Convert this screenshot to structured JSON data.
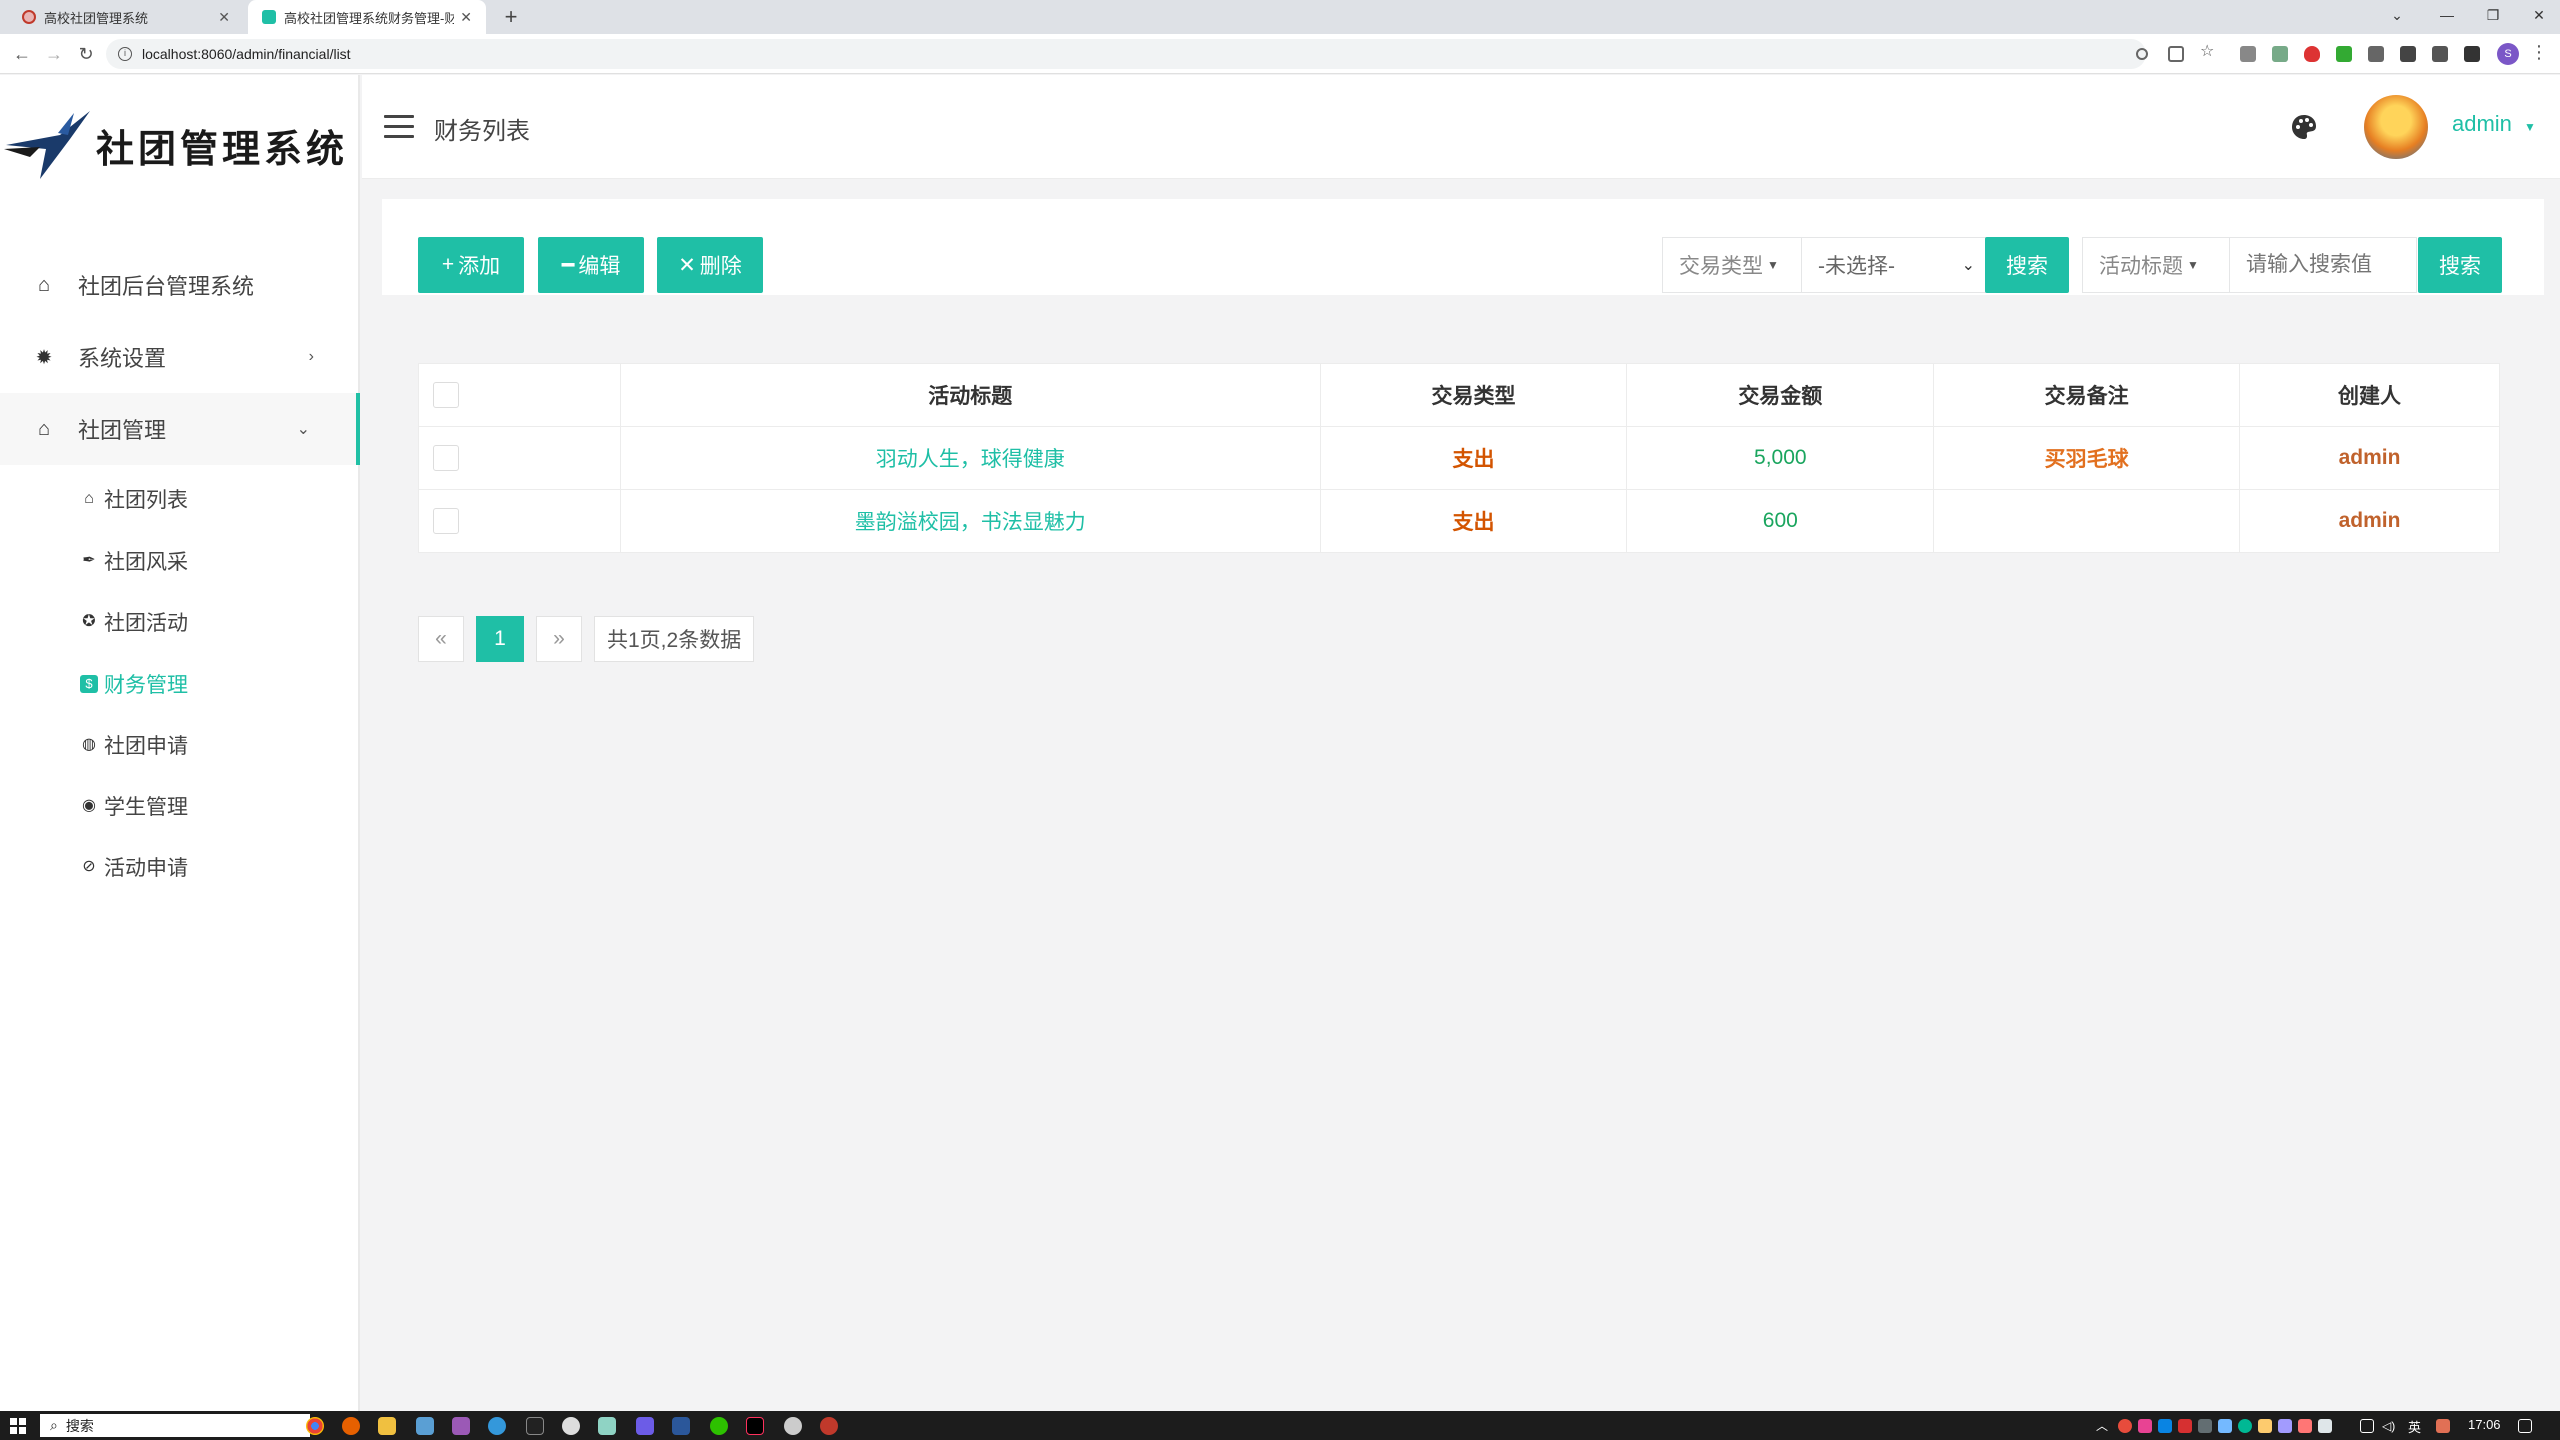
{
  "browser": {
    "tabs": [
      {
        "title": "高校社团管理系统",
        "active": false
      },
      {
        "title": "高校社团管理系统财务管理-财务",
        "active": true
      }
    ],
    "url": "localhost:8060/admin/financial/list",
    "profile_initial": "S"
  },
  "sidebar": {
    "brand": "社团管理系统",
    "items": [
      {
        "label": "社团后台管理系统",
        "icon": "home-icon"
      },
      {
        "label": "系统设置",
        "icon": "gear-icon"
      },
      {
        "label": "社团管理",
        "icon": "group-icon"
      }
    ],
    "sub_items": [
      {
        "label": "社团列表",
        "icon": "home-icon"
      },
      {
        "label": "社团风采",
        "icon": "feather-icon"
      },
      {
        "label": "社团活动",
        "icon": "star-icon"
      },
      {
        "label": "财务管理",
        "icon": "dollar-icon",
        "active": true
      },
      {
        "label": "社团申请",
        "icon": "ball-icon"
      },
      {
        "label": "学生管理",
        "icon": "user-icon"
      },
      {
        "label": "活动申请",
        "icon": "ban-icon"
      }
    ]
  },
  "header": {
    "title": "财务列表",
    "user": "admin"
  },
  "toolbar": {
    "add_label": "添加",
    "edit_label": "编辑",
    "delete_label": "删除",
    "filter1_label": "交易类型",
    "filter1_value": "-未选择-",
    "search1_label": "搜索",
    "filter2_label": "活动标题",
    "search_placeholder": "请输入搜索值",
    "search2_label": "搜索"
  },
  "table": {
    "columns": [
      "活动标题",
      "交易类型",
      "交易金额",
      "交易备注",
      "创建人"
    ],
    "rows": [
      {
        "title": "羽动人生，球得健康",
        "type": "支出",
        "amount": "5,000",
        "note": "买羽毛球",
        "creator": "admin"
      },
      {
        "title": "墨韵溢校园，书法显魅力",
        "type": "支出",
        "amount": "600",
        "note": "",
        "creator": "admin"
      }
    ]
  },
  "pager": {
    "prev": "«",
    "current": "1",
    "next": "»",
    "info": "共1页,2条数据"
  },
  "taskbar": {
    "search_label": "搜索",
    "time": "17:06",
    "lang": "英"
  },
  "colors": {
    "accent": "#1fbfa6",
    "type_color": "#d35400",
    "amount_color": "#1aa55e"
  }
}
